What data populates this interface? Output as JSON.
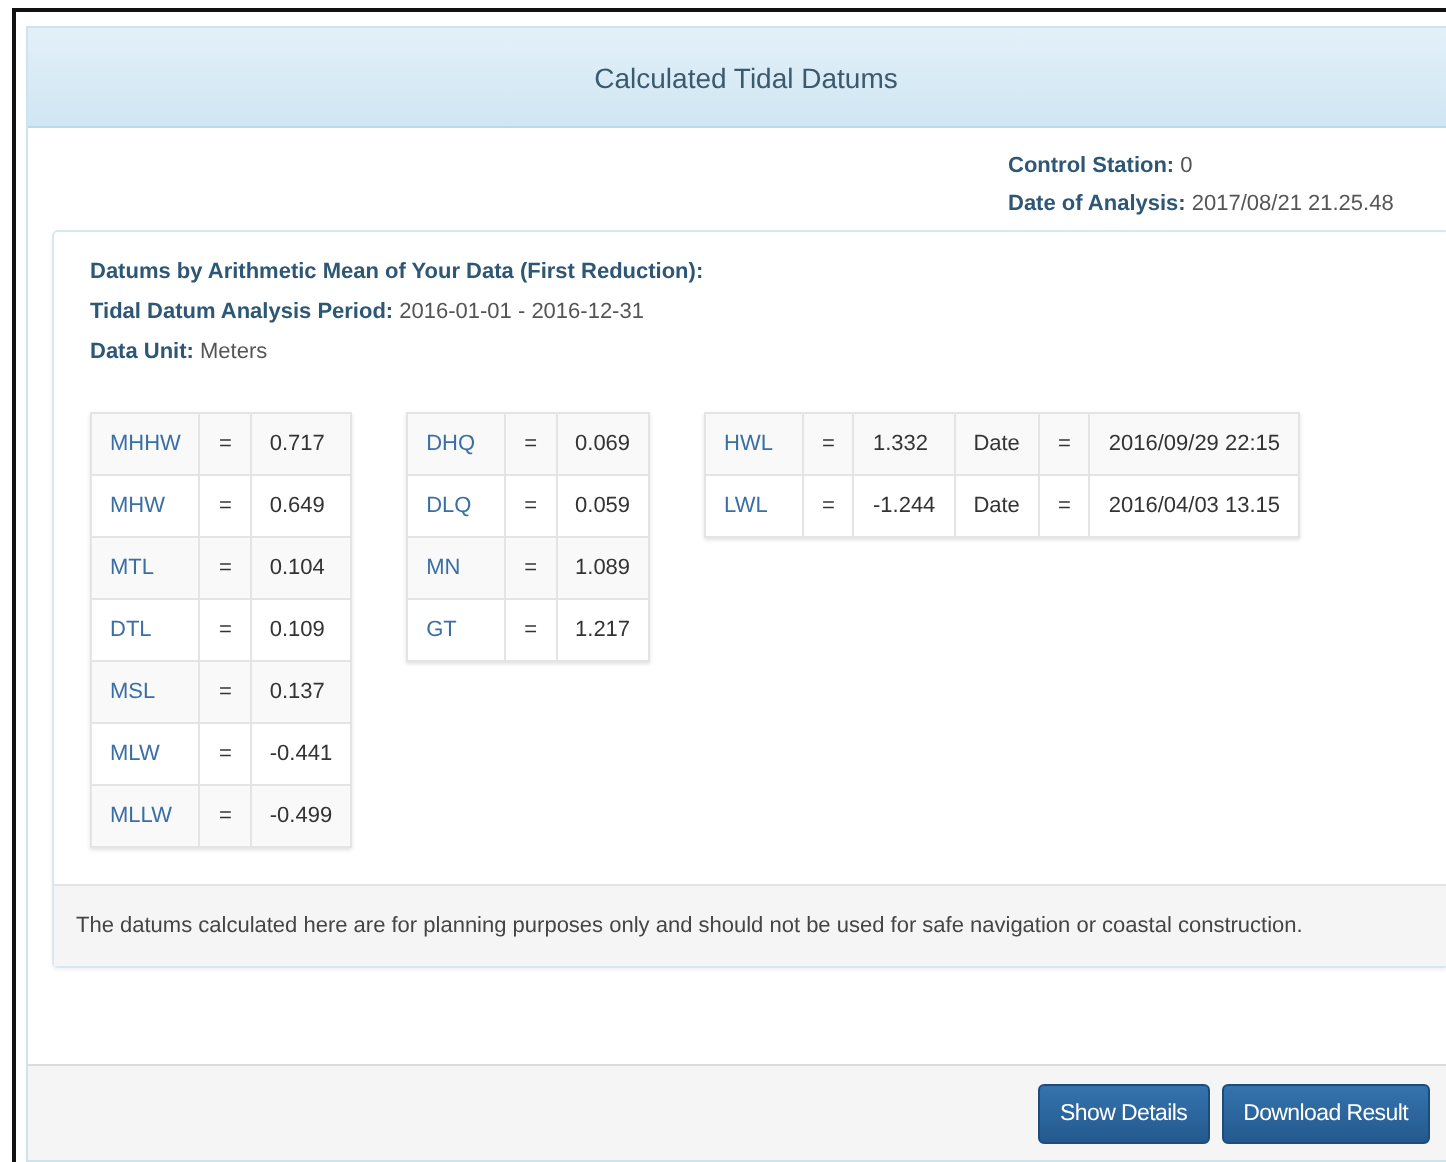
{
  "modal": {
    "title": "Calculated Tidal Datums"
  },
  "info": [
    {
      "label": "Control Station:",
      "value": "0"
    },
    {
      "label": "Date of Analysis:",
      "value": "2017/08/21 21.25.48"
    }
  ],
  "panel": {
    "lines": [
      {
        "label": "Datums by Arithmetic Mean of Your Data (First Reduction):"
      },
      {
        "label": "Tidal Datum Analysis Period:",
        "value": "2016-01-01 - 2016-12-31"
      },
      {
        "label": "Data Unit:",
        "value": "Meters"
      }
    ],
    "tables": [
      {
        "rows": [
          [
            "MHHW",
            "=",
            "0.717"
          ],
          [
            "MHW",
            "=",
            "0.649"
          ],
          [
            "MTL",
            "=",
            "0.104"
          ],
          [
            "DTL",
            "=",
            "0.109"
          ],
          [
            "MSL",
            "=",
            "0.137"
          ],
          [
            "MLW",
            "=",
            "-0.441"
          ],
          [
            "MLLW",
            "=",
            "-0.499"
          ]
        ]
      },
      {
        "rows": [
          [
            "DHQ",
            "=",
            "0.069"
          ],
          [
            "DLQ",
            "=",
            "0.059"
          ],
          [
            "MN",
            "=",
            "1.089"
          ],
          [
            "GT",
            "=",
            "1.217"
          ]
        ]
      },
      {
        "rows": [
          [
            "HWL",
            "=",
            "1.332",
            "Date",
            "=",
            "2016/09/29 22:15"
          ],
          [
            "LWL",
            "=",
            "-1.244",
            "Date",
            "=",
            "2016/04/03 13.15"
          ]
        ]
      }
    ],
    "footer": "The datums calculated here are for planning purposes only and should not be used for safe navigation or coastal construction."
  },
  "buttons": [
    "Show Details",
    "Download Result"
  ]
}
